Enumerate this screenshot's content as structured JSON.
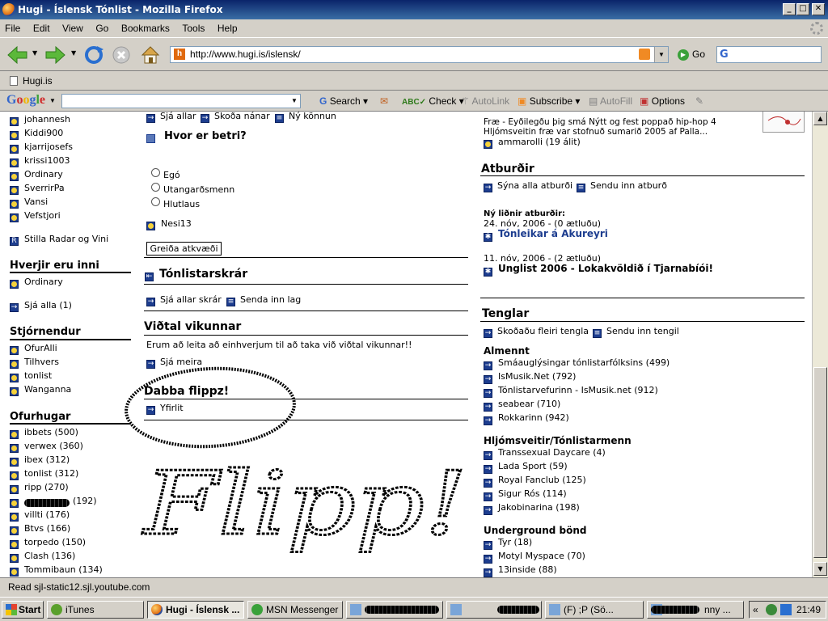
{
  "window": {
    "title": "Hugi - Íslensk Tónlist - Mozilla Firefox"
  },
  "menu": [
    "File",
    "Edit",
    "View",
    "Go",
    "Bookmarks",
    "Tools",
    "Help"
  ],
  "address": {
    "url": "http://www.hugi.is/islensk/",
    "go": "Go"
  },
  "bookmarks": [
    "Hugi.is"
  ],
  "google_toolbar": {
    "logo": "Google",
    "search": "Search",
    "check": "Check",
    "autolink": "AutoLink",
    "subscribe": "Subscribe",
    "autofill": "AutoFill",
    "options": "Options"
  },
  "left": {
    "users_top": [
      "johannesh",
      "Kiddi900",
      "kjarrijosefs",
      "krissi1003",
      "Ordinary",
      "SverrirPa",
      "Vansi",
      "Vefstjori"
    ],
    "radar_link": "Stilla Radar og Vini",
    "inside_heading": "Hverjir eru inni",
    "inside_users": [
      "Ordinary"
    ],
    "see_all": "Sjá alla (1)",
    "admins_heading": "Stjórnendur",
    "admins": [
      "OfurAlli",
      "Tilhvers",
      "tonlist",
      "Wanganna"
    ],
    "super_heading": "Ofurhugar",
    "super_users": [
      "ibbets (500)",
      "verwex (360)",
      "ibex (312)",
      "tonlist (312)",
      "ripp (270)",
      "(192)",
      "villti (176)",
      "Btvs (166)",
      "torpedo (150)",
      "Clash (136)",
      "Tommibaun (134)"
    ]
  },
  "middle": {
    "links_top": [
      "Sjá allar",
      "Skoða nánar",
      "Ný könnun"
    ],
    "poll_heading": "Hvor er betri?",
    "poll_options": [
      "Egó",
      "Utangarðsmenn",
      "Hlutlaus"
    ],
    "poll_user": "Nesi13",
    "vote_button": "Greiða atkvæði",
    "list_heading": "Tónlistarskrár",
    "list_links": [
      "Sjá allar skrár",
      "Senda inn lag"
    ],
    "interview_heading": "Viðtal vikunnar",
    "interview_text": "Erum að leita að einhverjum til að taka við viðtal vikunnar!!",
    "interview_more": "Sjá meira",
    "flipp_heading": "Dabba flippz!",
    "flipp_link": "Yfirlit",
    "scrawl": "Flipp!"
  },
  "right": {
    "news_line1": "Fræ - Eyðilegðu þig smá Nýtt og fest poppað hip-hop 4",
    "news_line2": "Hljómsveitin fræ var stofnuð sumarið 2005 af Palla...",
    "news_user": "ammarolli (19 álit)",
    "events_heading": "Atburðir",
    "events_links": [
      "Sýna alla atburði",
      "Sendu inn atburð"
    ],
    "events_subheading": "Ný liðnir atburðir:",
    "event1_date": "24. nóv, 2006 - (0 ætluðu)",
    "event1_title": "Tónleikar á Akureyri",
    "event2_date": "11. nóv, 2006 - (2 ætluðu)",
    "event2_title": "Unglist 2006 - Lokakvöldið í Tjarnabíói!",
    "links_heading": "Tenglar",
    "links_links": [
      "Skoðaðu fleiri tengla",
      "Sendu inn tengil"
    ],
    "general_heading": "Almennt",
    "general": [
      "Smáauglýsingar tónlistarfólksins (499)",
      "IsMusik.Net (792)",
      "Tónlistarvefurinn - IsMusik.net (912)",
      "seabear (710)",
      "Rokkarinn (942)"
    ],
    "bands_heading": "Hljómsveitir/Tónlistarmenn",
    "bands": [
      "Transsexual Daycare (4)",
      "Lada Sport (59)",
      "Royal Fanclub (125)",
      "Sigur Rós (114)",
      "Jakobinarina (198)"
    ],
    "underground_heading": "Underground bönd",
    "underground": [
      "Tyr (18)",
      "Motyl Myspace (70)",
      "13inside (88)"
    ]
  },
  "status": "Read sjl-static12.sjl.youtube.com",
  "taskbar": {
    "start": "Start",
    "items": [
      "iTunes",
      "Hugi - Íslensk ...",
      "MSN Messenger",
      "(F) ;P (Sö...",
      "nny ..."
    ],
    "clock": "21:49"
  }
}
